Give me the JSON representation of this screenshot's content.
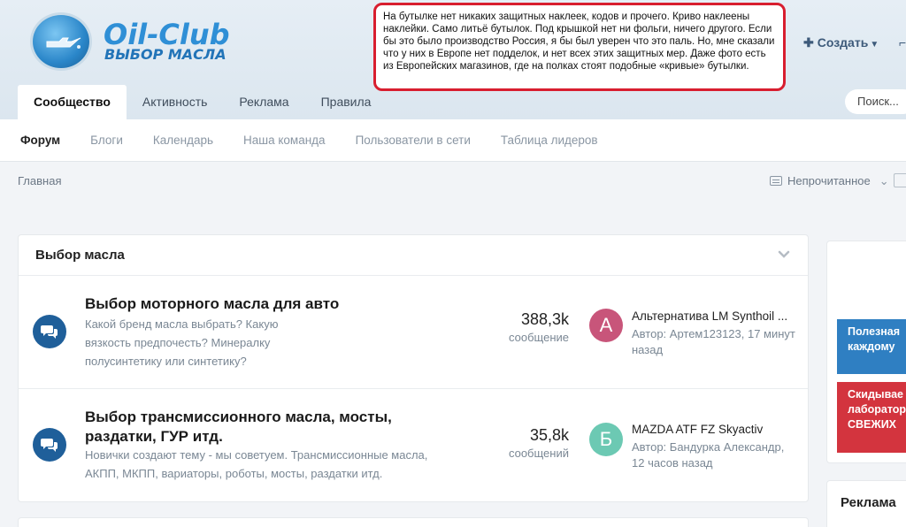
{
  "header": {
    "logo_title": "Oil-Club",
    "logo_subtitle": "ВЫБОР МАСЛА",
    "note": "На бутылке нет никаких защитных наклеек, кодов и прочего. Криво наклеены наклейки. Само литьё бутылок. Под крышкой нет ни фольги, ничего другого. Если бы это было производство Россия, я бы был уверен что это паль. Но, мне сказали что у них в Европе нет подделок, и нет всех этих защитных мер. Даже фото есть из Европейских магазинов, где на полках стоят подобные «кривые» бутылки.",
    "create_label": "Создать",
    "search_placeholder": "Поиск..."
  },
  "tabs": [
    {
      "label": "Сообщество",
      "active": true
    },
    {
      "label": "Активность"
    },
    {
      "label": "Реклама"
    },
    {
      "label": "Правила"
    }
  ],
  "subnav": [
    {
      "label": "Форум",
      "active": true
    },
    {
      "label": "Блоги"
    },
    {
      "label": "Календарь"
    },
    {
      "label": "Наша команда"
    },
    {
      "label": "Пользователи в сети"
    },
    {
      "label": "Таблица лидеров"
    }
  ],
  "breadcrumb": "Главная",
  "unread_label": "Непрочитанное",
  "category": {
    "title": "Выбор масла",
    "forums": [
      {
        "title_lines": [
          "Выбор моторного масла для авто"
        ],
        "desc_lines": [
          "Какой бренд масла выбрать? Какую",
          "вязкость предпочесть? Минералку",
          "полусинтетику или синтетику?"
        ],
        "count": "388,3k",
        "count_label": "сообщение",
        "last_title": "Альтернатива LM Synthoil ...",
        "last_meta_lines": [
          "Автор: Артем123123, 17 минут",
          "назад"
        ],
        "avatar_letter": "А",
        "avatar_color": "#c8557a"
      },
      {
        "title_lines": [
          "Выбор трансмиссионного масла, мосты,",
          "раздатки, ГУР итд."
        ],
        "desc_lines": [
          "Новички создают тему - мы советуем. Трансмиссионные масла,",
          "АКПП, МКПП, вариаторы, роботы, мосты, раздатки итд."
        ],
        "count": "35,8k",
        "count_label": "сообщений",
        "last_title": "MAZDA ATF FZ Skyactiv",
        "last_meta_lines": [
          "Автор: Бандурка Александр,",
          "12 часов назад"
        ],
        "avatar_letter": "Б",
        "avatar_color": "#6cc9b3"
      }
    ]
  },
  "sidebar": {
    "banner1_lines": [
      "Полезная",
      "каждому"
    ],
    "banner2_lines": [
      "Скидывае",
      "лаборатор",
      "СВЕЖИХ"
    ],
    "ads_title": "Реклама"
  }
}
